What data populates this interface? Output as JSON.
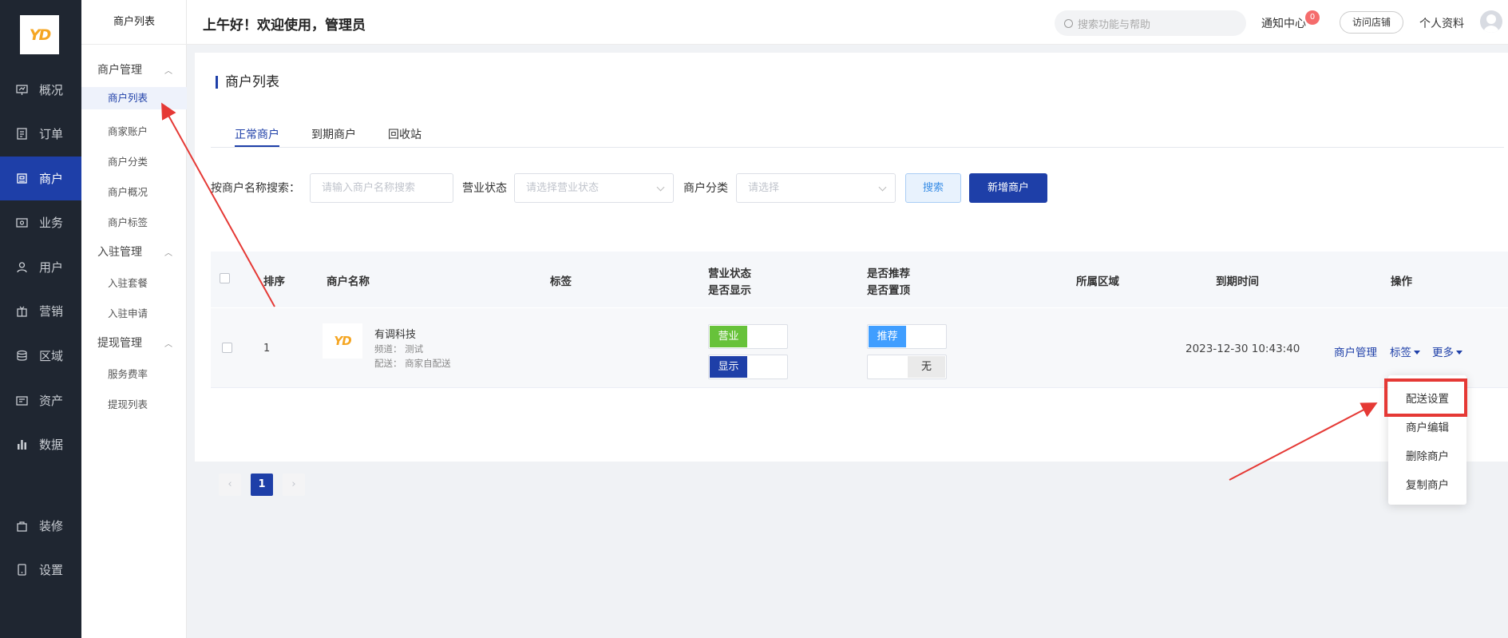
{
  "logo_text": "YD",
  "sidebar": {
    "items": [
      {
        "label": "概况",
        "icon": "chart-board-icon"
      },
      {
        "label": "订单",
        "icon": "document-icon"
      },
      {
        "label": "商户",
        "icon": "store-icon",
        "active": true
      },
      {
        "label": "业务",
        "icon": "briefcase-icon"
      },
      {
        "label": "用户",
        "icon": "user-icon"
      },
      {
        "label": "营销",
        "icon": "gift-icon"
      },
      {
        "label": "区域",
        "icon": "database-icon"
      },
      {
        "label": "资产",
        "icon": "wallet-icon"
      },
      {
        "label": "数据",
        "icon": "bar-chart-icon"
      },
      {
        "label": "装修",
        "icon": "paint-bag-icon"
      },
      {
        "label": "设置",
        "icon": "phone-settings-icon"
      }
    ]
  },
  "subnav": {
    "title": "商户列表",
    "groups": [
      {
        "label": "商户管理",
        "items": [
          "商户列表",
          "商家账户",
          "商户分类",
          "商户概况",
          "商户标签"
        ]
      },
      {
        "label": "入驻管理",
        "items": [
          "入驻套餐",
          "入驻申请"
        ]
      },
      {
        "label": "提现管理",
        "items": [
          "服务费率",
          "提现列表"
        ]
      }
    ]
  },
  "header": {
    "greeting": "上午好！欢迎使用，管理员",
    "search_placeholder": "搜索功能与帮助",
    "notice_label": "通知中心",
    "notice_count": "0",
    "visit_store": "访问店铺",
    "profile": "个人资料"
  },
  "page": {
    "title": "商户列表",
    "tabs": [
      "正常商户",
      "到期商户",
      "回收站"
    ],
    "filters": {
      "name_label": "按商户名称搜索：",
      "name_placeholder": "请输入商户名称搜索",
      "status_label": "营业状态",
      "status_placeholder": "请选择营业状态",
      "category_label": "商户分类",
      "category_placeholder": "请选择"
    },
    "search_button": "搜索",
    "add_button": "新增商户"
  },
  "table": {
    "columns": {
      "sort": "排序",
      "name": "商户名称",
      "tags": "标签",
      "status_1": "营业状态",
      "status_2": "是否显示",
      "rec_1": "是否推荐",
      "rec_2": "是否置顶",
      "region": "所属区域",
      "expire": "到期时间",
      "actions": "操作"
    },
    "rows": [
      {
        "sort": "1",
        "name": "有调科技",
        "channel": "频道： 测试",
        "delivery": "配送： 商家自配送",
        "status_on": "营业",
        "display_on": "显示",
        "recommend_on": "推荐",
        "top_off": "无",
        "region": "",
        "expire": "2023-12-30 10:43:40",
        "actions": {
          "manage": "商户管理",
          "tag": "标签",
          "more": "更多"
        }
      }
    ]
  },
  "pagination": {
    "current": "1",
    "prev": "‹",
    "next": "›"
  },
  "dropdown": {
    "items": [
      "配送设置",
      "商户编辑",
      "删除商户",
      "复制商户"
    ]
  },
  "colors": {
    "primary": "#1e3fa8",
    "sidebar_bg": "#1f2631",
    "status_green": "#67c23a",
    "recommend_blue": "#409eff",
    "highlight_red": "#e53935"
  }
}
